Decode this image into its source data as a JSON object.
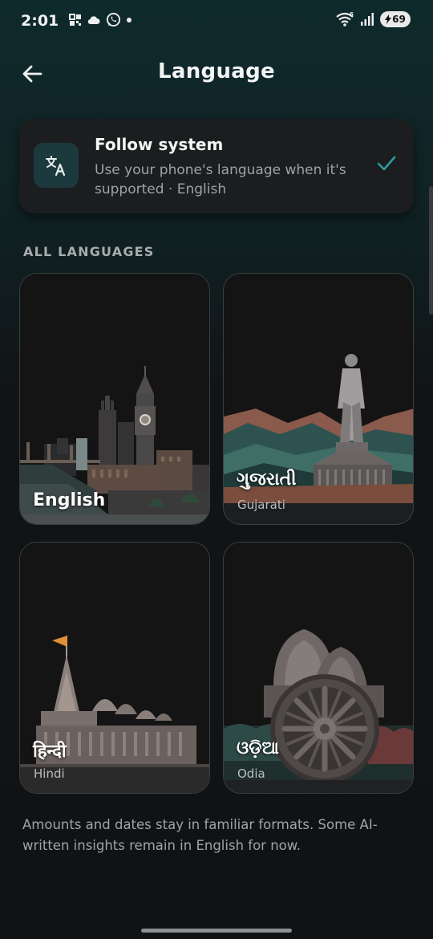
{
  "status_bar": {
    "time": "2:01",
    "battery_level": "69",
    "left_icons": [
      "grid-qr-icon",
      "cloud-icon",
      "whatsapp-icon",
      "notification-dot"
    ],
    "right_icons": [
      "wifi-6-icon",
      "signal-icon",
      "battery-icon"
    ]
  },
  "header": {
    "title": "Language",
    "back_icon": "arrow-left-icon"
  },
  "follow_system": {
    "title": "Follow system",
    "subtitle": "Use your phone's language when it's supported · English",
    "icon": "translate-icon",
    "selected": true,
    "accent": "#2a9da0"
  },
  "section": {
    "label": "ALL LANGUAGES"
  },
  "languages": [
    {
      "name": "English",
      "native": "",
      "art": "london-skyline"
    },
    {
      "name": "ગુજરાતી",
      "native": "Gujarati",
      "art": "statue-of-unity"
    },
    {
      "name": "हिन्दी",
      "native": "Hindi",
      "art": "ram-mandir"
    },
    {
      "name": "ଓଡ଼ିଆ",
      "native": "Odia",
      "art": "konark-wheel"
    }
  ],
  "footer": {
    "note": "Amounts and dates stay in familiar formats. Some AI-written insights remain in English for now."
  }
}
